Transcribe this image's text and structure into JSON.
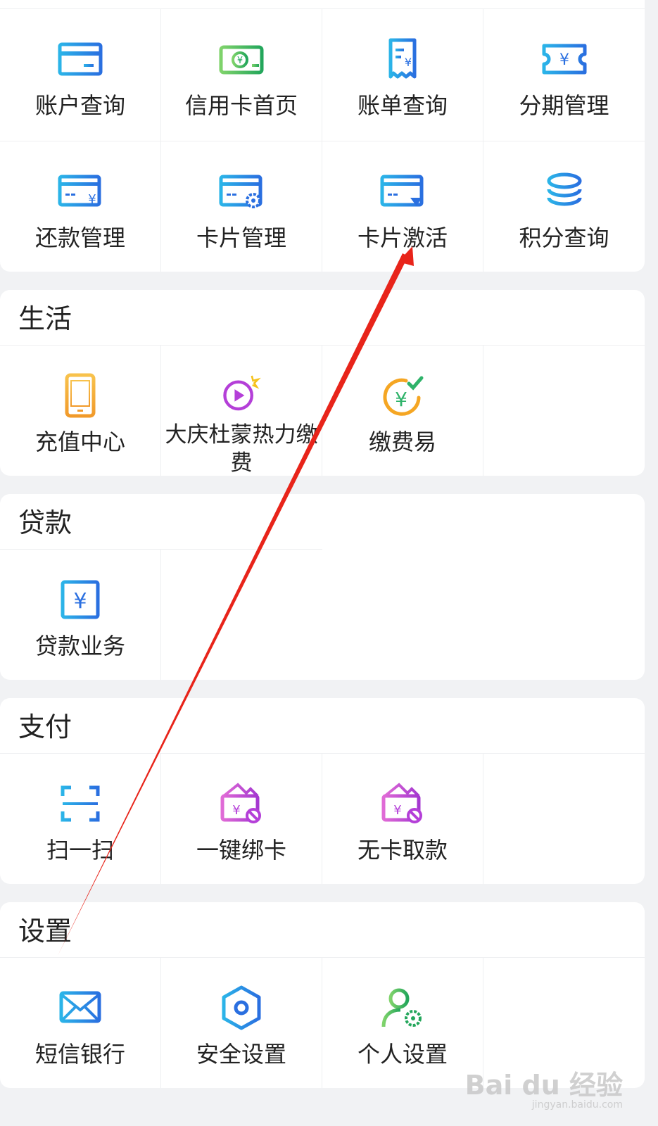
{
  "credit": {
    "items": [
      {
        "label": "账户查询",
        "icon": "card-icon"
      },
      {
        "label": "信用卡首页",
        "icon": "money-icon"
      },
      {
        "label": "账单查询",
        "icon": "bill-icon"
      },
      {
        "label": "分期管理",
        "icon": "ticket-icon"
      },
      {
        "label": "还款管理",
        "icon": "repay-card-icon"
      },
      {
        "label": "卡片管理",
        "icon": "card-gear-icon"
      },
      {
        "label": "卡片激活",
        "icon": "card-activate-icon"
      },
      {
        "label": "积分查询",
        "icon": "coins-stack-icon"
      }
    ]
  },
  "life": {
    "title": "生活",
    "items": [
      {
        "label": "充值中心",
        "icon": "phone-icon"
      },
      {
        "label": "大庆杜蒙热力缴费",
        "icon": "play-icon"
      },
      {
        "label": "缴费易",
        "icon": "yuan-check-icon"
      }
    ]
  },
  "loan": {
    "title": "贷款",
    "items": [
      {
        "label": "贷款业务",
        "icon": "yuan-box-icon"
      }
    ]
  },
  "pay": {
    "title": "支付",
    "items": [
      {
        "label": "扫一扫",
        "icon": "scan-icon"
      },
      {
        "label": "一键绑卡",
        "icon": "wallet-ban-icon"
      },
      {
        "label": "无卡取款",
        "icon": "wallet-ban-icon"
      }
    ]
  },
  "settings": {
    "title": "设置",
    "items": [
      {
        "label": "短信银行",
        "icon": "mail-icon"
      },
      {
        "label": "安全设置",
        "icon": "shield-hex-icon"
      },
      {
        "label": "个人设置",
        "icon": "user-gear-icon"
      }
    ]
  },
  "colors": {
    "blue": "#2a7de1",
    "green": "#2fb36a",
    "orange": "#f5a623",
    "purple": "#b43fd8",
    "red_arrow": "#e8241a"
  },
  "watermark": {
    "brand": "Bai du 经验",
    "url": "jingyan.baidu.com"
  }
}
